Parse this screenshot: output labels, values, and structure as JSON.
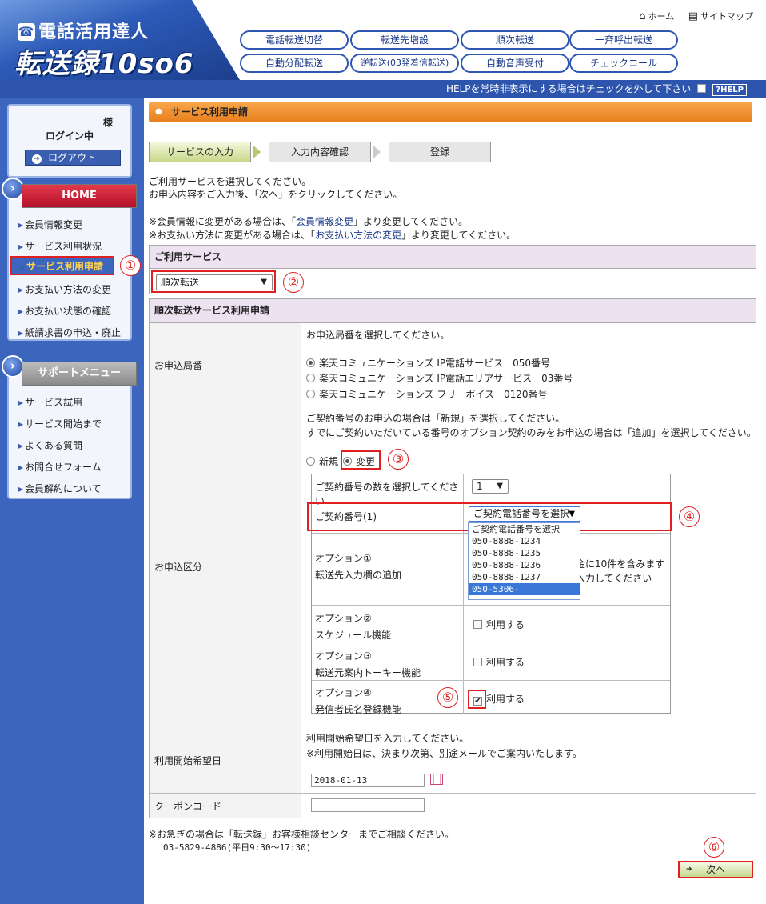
{
  "header": {
    "logo_line1": "電話活用達人",
    "logo_line2": "転送録10so6",
    "home_link": "ホーム",
    "sitemap_link": "サイトマップ",
    "nav": [
      "電話転送切替",
      "転送先増設",
      "順次転送",
      "一斉呼出転送",
      "自動分配転送",
      "逆転送(03発着信転送)",
      "自動音声受付",
      "チェックコール"
    ],
    "help_text": "HELPを常時非表示にする場合はチェックを外して下さい",
    "help_badge": "?HELP"
  },
  "sidebar": {
    "user_suffix": "様",
    "login_status": "ログイン中",
    "logout_label": "ログアウト",
    "home_label": "HOME",
    "home_items": [
      "会員情報変更",
      "サービス利用状況",
      "サービス利用申請",
      "お支払い方法の変更",
      "お支払い状態の確認",
      "紙請求書の申込・廃止"
    ],
    "support_label": "サポートメニュー",
    "support_items": [
      "サービス試用",
      "サービス開始まで",
      "よくある質問",
      "お問合せフォーム",
      "会員解約について"
    ]
  },
  "main": {
    "section_title": "サービス利用申請",
    "steps": [
      "サービスの入力",
      "入力内容確認",
      "登録"
    ],
    "intro1": "ご利用サービスを選択してください。",
    "intro2": "お申込内容をご入力後、「次へ」をクリックしてください。",
    "note1_pre": "※会員情報に変更がある場合は、「",
    "note1_link": "会員情報変更",
    "note1_post": "」より変更してください。",
    "note2_pre": "※お支払い方法に変更がある場合は、「",
    "note2_link": "お支払い方法の変更",
    "note2_post": "」より変更してください。",
    "service_header": "ご利用サービス",
    "service_selected": "順次転送",
    "form_header": "順次転送サービス利用申請",
    "office_label": "お申込局番",
    "office_prompt": "お申込局番を選択してください。",
    "office_options": [
      "楽天コミュニケーションズ IP電話サービス　050番号",
      "楽天コミュニケーションズ IP電話エリアサービス　03番号",
      "楽天コミュニケーションズ フリーボイス　0120番号"
    ],
    "type_label": "お申込区分",
    "type_note1": "ご契約番号のお申込の場合は「新規」を選択してください。",
    "type_note2": "すでにご契約いただいている番号のオプション契約のみをお申込の場合は「追加」を選択してください。",
    "type_new": "新規",
    "type_change": "変更",
    "count_label": "ご契約番号の数を選択してください",
    "count_value": "1",
    "contract_label": "ご契約番号(1)",
    "contract_selected": "ご契約電話番号を選択",
    "contract_options": [
      "ご契約電話番号を選択",
      "050-8888-1234",
      "050-8888-1235",
      "050-8888-1236",
      "050-8888-1237",
      "050-5306-"
    ],
    "opt1_title": "オプション①",
    "opt1_sub": "転送先入力欄の追加",
    "opt1_text1": "金に10件を含みます",
    "opt1_text2": "入力してください",
    "opt2_title": "オプション②",
    "opt2_sub": "スケジュール機能",
    "opt3_title": "オプション③",
    "opt3_sub": "転送元案内トーキー機能",
    "opt4_title": "オプション④",
    "opt4_sub": "発信者氏名登録機能",
    "use_label": "利用する",
    "start_label": "利用開始希望日",
    "start_note1": "利用開始希望日を入力してください。",
    "start_note2": "※利用開始日は、決まり次第、別途メールでご案内いたします。",
    "start_value": "2018-01-13",
    "coupon_label": "クーポンコード",
    "coupon_value": "",
    "contact1": "※お急ぎの場合は「転送録」お客様相談センターまでご相談ください。",
    "contact2": "03-5829-4886(平日9:30～17:30)",
    "next_label": "次へ"
  },
  "annotations": [
    "①",
    "②",
    "③",
    "④",
    "⑤",
    "⑥"
  ],
  "colors": {
    "accent_red": "#e02020",
    "sidebar_blue": "#3c66be",
    "header_orange": "#f29a3a"
  }
}
